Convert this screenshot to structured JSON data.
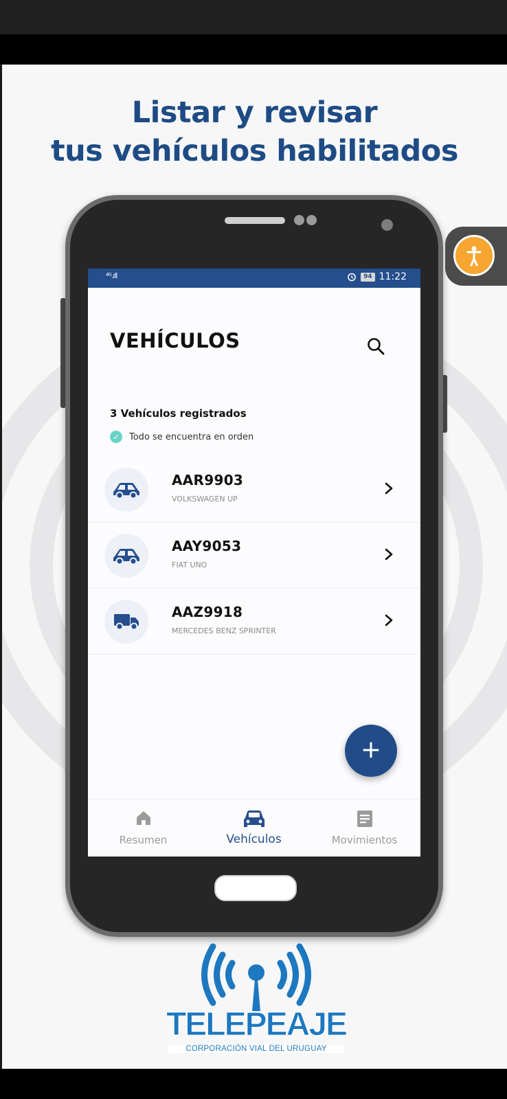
{
  "headline": {
    "line1": "Listar y revisar",
    "line2": "tus vehículos habilitados"
  },
  "status_bar": {
    "signal": "⁴ᴳ.ıll",
    "battery": "94",
    "time": "11:22"
  },
  "app": {
    "title": "VEHÍCULOS",
    "registered_count": "3 Vehículos registrados",
    "status_message": "Todo se encuentra en orden",
    "vehicles": [
      {
        "plate": "AAR9903",
        "model": "VOLKSWAGEN UP",
        "icon": "car-icon"
      },
      {
        "plate": "AAY9053",
        "model": "FIAT UNO",
        "icon": "car-icon"
      },
      {
        "plate": "AAZ9918",
        "model": "MERCEDES BENZ SPRINTER",
        "icon": "truck-icon"
      }
    ],
    "fab_label": "+",
    "nav": [
      {
        "label": "Resumen",
        "icon": "home-icon",
        "active": false
      },
      {
        "label": "Vehículos",
        "icon": "car-icon",
        "active": true
      },
      {
        "label": "Movimientos",
        "icon": "document-icon",
        "active": false
      }
    ]
  },
  "logo": {
    "name": "TELEPEAJE",
    "subtitle": "CORPORACIÓN VIAL DEL URUGUAY"
  },
  "colors": {
    "brand_blue": "#1e4b84",
    "accent_orange": "#f6a631",
    "ok_teal": "#6ad3c6"
  }
}
